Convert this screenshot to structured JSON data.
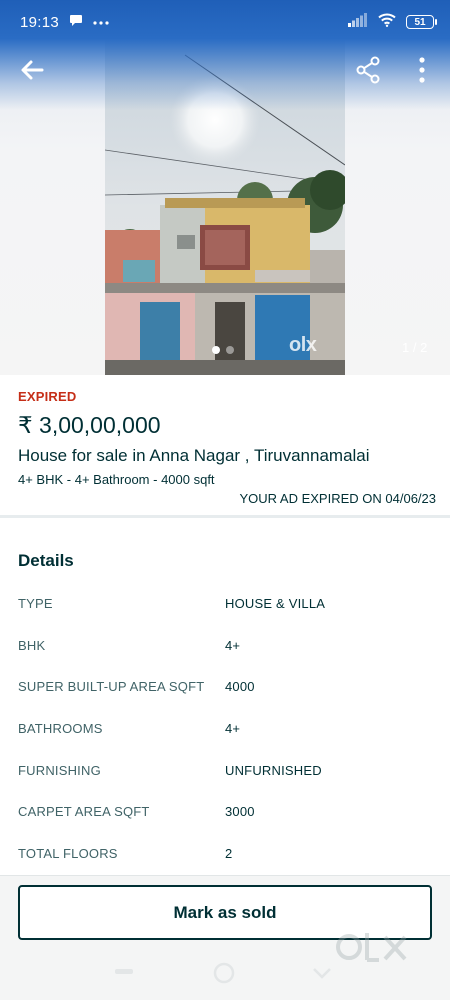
{
  "status_bar": {
    "time": "19:13",
    "battery": "51"
  },
  "gallery": {
    "page_counter": "1 / 2",
    "watermark": "olx",
    "current_index": 1,
    "total": 2
  },
  "listing": {
    "status": "EXPIRED",
    "price": "₹ 3,00,00,000",
    "title": "House for sale in Anna Nagar , Tiruvannamalai",
    "summary": "4+ BHK - 4+ Bathroom - 4000 sqft",
    "expired_on": "YOUR AD EXPIRED ON 04/06/23"
  },
  "details": {
    "heading": "Details",
    "rows": [
      {
        "key": "TYPE",
        "value": "HOUSE & VILLA"
      },
      {
        "key": "BHK",
        "value": "4+"
      },
      {
        "key": "SUPER BUILT-UP AREA SQFT",
        "value": "4000"
      },
      {
        "key": "BATHROOMS",
        "value": "4+"
      },
      {
        "key": "FURNISHING",
        "value": "UNFURNISHED"
      },
      {
        "key": "CARPET AREA SQFT",
        "value": "3000"
      },
      {
        "key": "TOTAL FLOORS",
        "value": "2"
      }
    ]
  },
  "actions": {
    "mark_sold": "Mark as sold"
  },
  "colors": {
    "expired": "#c52e17",
    "text": "#002f34",
    "status_bar": "#1f5fb8"
  },
  "icons": [
    "back-arrow-icon",
    "share-icon",
    "more-vertical-icon",
    "message-icon",
    "signal-icon",
    "wifi-icon",
    "battery-icon"
  ]
}
